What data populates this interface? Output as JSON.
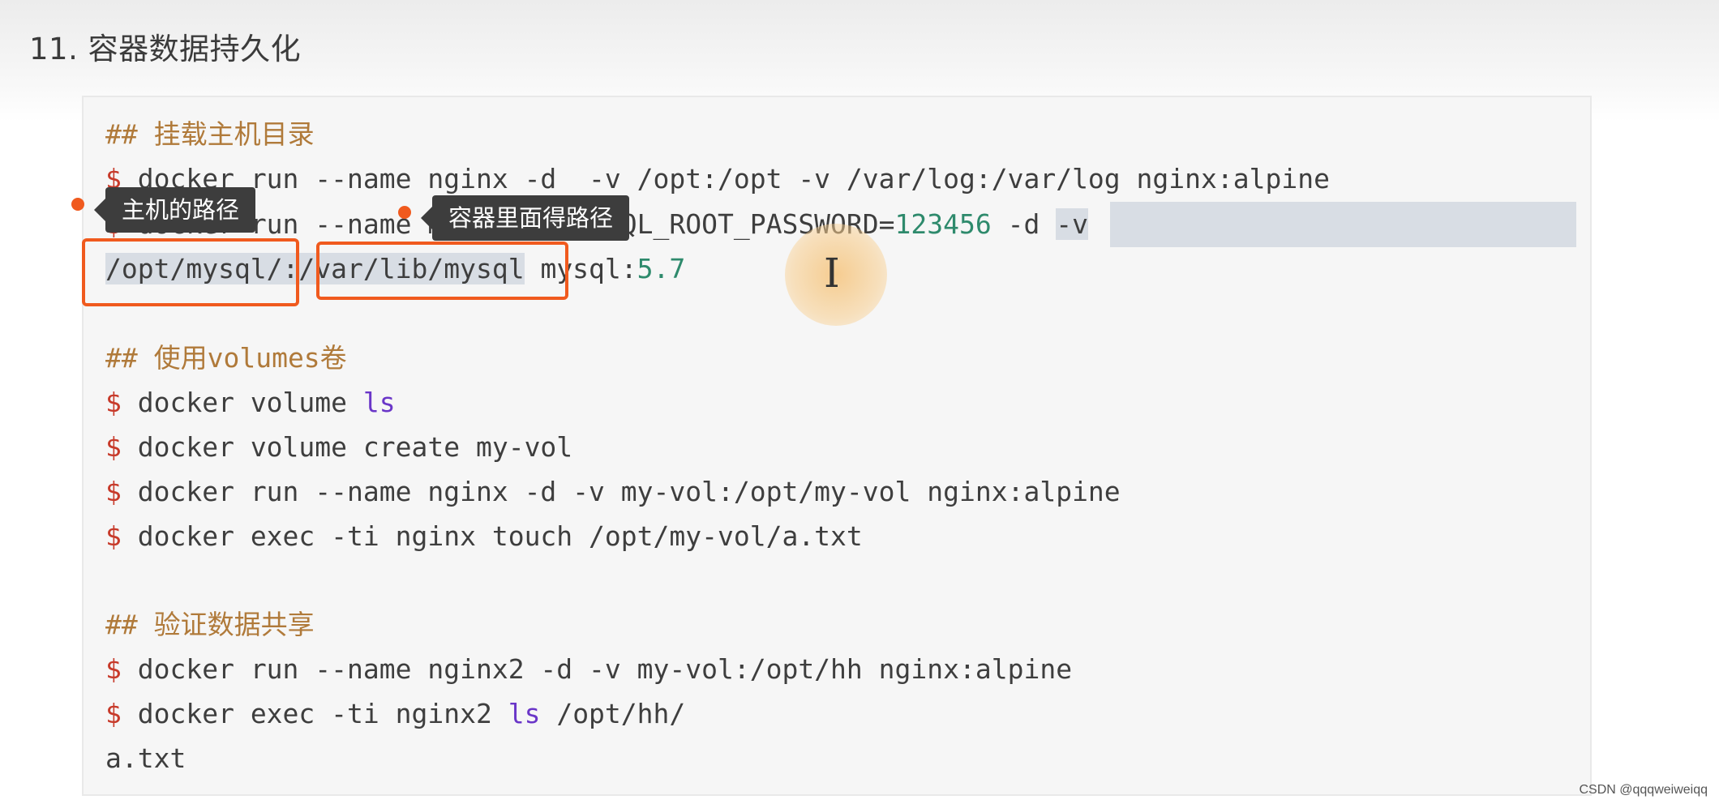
{
  "heading": "11. 容器数据持久化",
  "code": {
    "c1": "## 挂载主机目录",
    "l1": {
      "prompt": "$",
      "text": " docker run --name nginx -d  -v /opt:/opt -v /var/log:/var/log nginx:alpine"
    },
    "l2": {
      "prompt": "$",
      "a": " docker run --name mysql -e MYSQL_ROOT_PASSWORD=",
      "num": "123456",
      "b": " -d ",
      "c": "-v"
    },
    "l3": {
      "a": "/opt/mysql/",
      "b": ":",
      "c": "/var/lib/mysql",
      "d": " mysql:",
      "num": "5.7"
    },
    "c2": "## 使用volumes卷",
    "l4": {
      "prompt": "$",
      "a": " docker volume ",
      "kw": "ls"
    },
    "l5": {
      "prompt": "$",
      "text": " docker volume create my-vol"
    },
    "l6": {
      "prompt": "$",
      "text": " docker run --name nginx -d -v my-vol:/opt/my-vol nginx:alpine"
    },
    "l7": {
      "prompt": "$",
      "text": " docker exec -ti nginx touch /opt/my-vol/a.txt"
    },
    "c3": "## 验证数据共享",
    "l8": {
      "prompt": "$",
      "text": " docker run --name nginx2 -d -v my-vol:/opt/hh nginx:alpine"
    },
    "l9": {
      "prompt": "$",
      "a": " docker exec -ti nginx2 ",
      "kw": "ls",
      "b": " /opt/hh/"
    },
    "l10": "a.txt"
  },
  "tooltips": {
    "host": "主机的路径",
    "container": "容器里面得路径"
  },
  "watermark": "CSDN @qqqweiweiqq",
  "colors": {
    "prompt": "#c73a2a",
    "comment": "#b07a3a",
    "keyword": "#6a36c8",
    "number": "#2e8a6c",
    "highlight_box": "#f05a1e",
    "selection": "#d8dde4",
    "tooltip_bg": "#3d3d3d"
  },
  "icons": {
    "cursor": "text-cursor-icon",
    "marker": "orange-dot-icon"
  }
}
